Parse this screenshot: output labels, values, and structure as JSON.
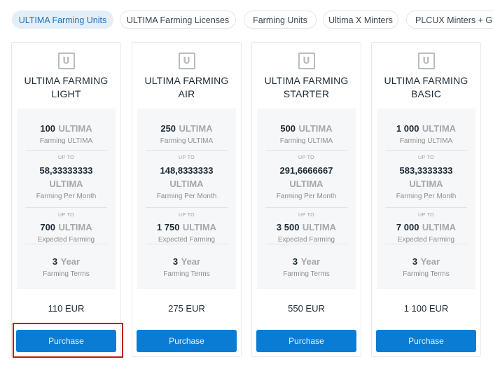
{
  "tabs": [
    {
      "label": "ULTIMA Farming Units"
    },
    {
      "label": "ULTIMA Farming Licenses"
    },
    {
      "label": "Farming Units"
    },
    {
      "label": "Ultima X Minters"
    },
    {
      "label": "PLCUX Minters + G"
    }
  ],
  "logo_letter": "U",
  "cards": [
    {
      "title_line1": "ULTIMA FARMING",
      "title_line2": "LIGHT",
      "amount_num": "100",
      "amount_unit": "ULTIMA",
      "amount_label": "Farming ULTIMA",
      "upto_label": "UP TO",
      "monthly_num": "58,33333333",
      "monthly_unit": "ULTIMA",
      "monthly_label": "Farming Per Month",
      "upto_label2": "UP TO",
      "expected_num": "700",
      "expected_unit": "ULTIMA",
      "expected_label": "Expected Farming",
      "term_num": "3",
      "term_unit": "Year",
      "term_label": "Farming Terms",
      "price": "110 EUR",
      "button": "Purchase"
    },
    {
      "title_line1": "ULTIMA FARMING",
      "title_line2": "AIR",
      "amount_num": "250",
      "amount_unit": "ULTIMA",
      "amount_label": "Farming ULTIMA",
      "upto_label": "UP TO",
      "monthly_num": "148,8333333",
      "monthly_unit": "ULTIMA",
      "monthly_label": "Farming Per Month",
      "upto_label2": "UP TO",
      "expected_num": "1 750",
      "expected_unit": "ULTIMA",
      "expected_label": "Expected Farming",
      "term_num": "3",
      "term_unit": "Year",
      "term_label": "Farming Terms",
      "price": "275 EUR",
      "button": "Purchase"
    },
    {
      "title_line1": "ULTIMA FARMING",
      "title_line2": "STARTER",
      "amount_num": "500",
      "amount_unit": "ULTIMA",
      "amount_label": "Farming ULTIMA",
      "upto_label": "UP TO",
      "monthly_num": "291,6666667",
      "monthly_unit": "ULTIMA",
      "monthly_label": "Farming Per Month",
      "upto_label2": "UP TO",
      "expected_num": "3 500",
      "expected_unit": "ULTIMA",
      "expected_label": "Expected Farming",
      "term_num": "3",
      "term_unit": "Year",
      "term_label": "Farming Terms",
      "price": "550 EUR",
      "button": "Purchase"
    },
    {
      "title_line1": "ULTIMA FARMING",
      "title_line2": "BASIC",
      "amount_num": "1 000",
      "amount_unit": "ULTIMA",
      "amount_label": "Farming ULTIMA",
      "upto_label": "UP TO",
      "monthly_num": "583,3333333",
      "monthly_unit": "ULTIMA",
      "monthly_label": "Farming Per Month",
      "upto_label2": "UP TO",
      "expected_num": "7 000",
      "expected_unit": "ULTIMA",
      "expected_label": "Expected Farming",
      "term_num": "3",
      "term_unit": "Year",
      "term_label": "Farming Terms",
      "price": "1 100 EUR",
      "button": "Purchase"
    }
  ],
  "colors": {
    "accent": "#0a7cd3",
    "active_tab_bg": "#e3eef8",
    "highlight": "#c0171d"
  }
}
